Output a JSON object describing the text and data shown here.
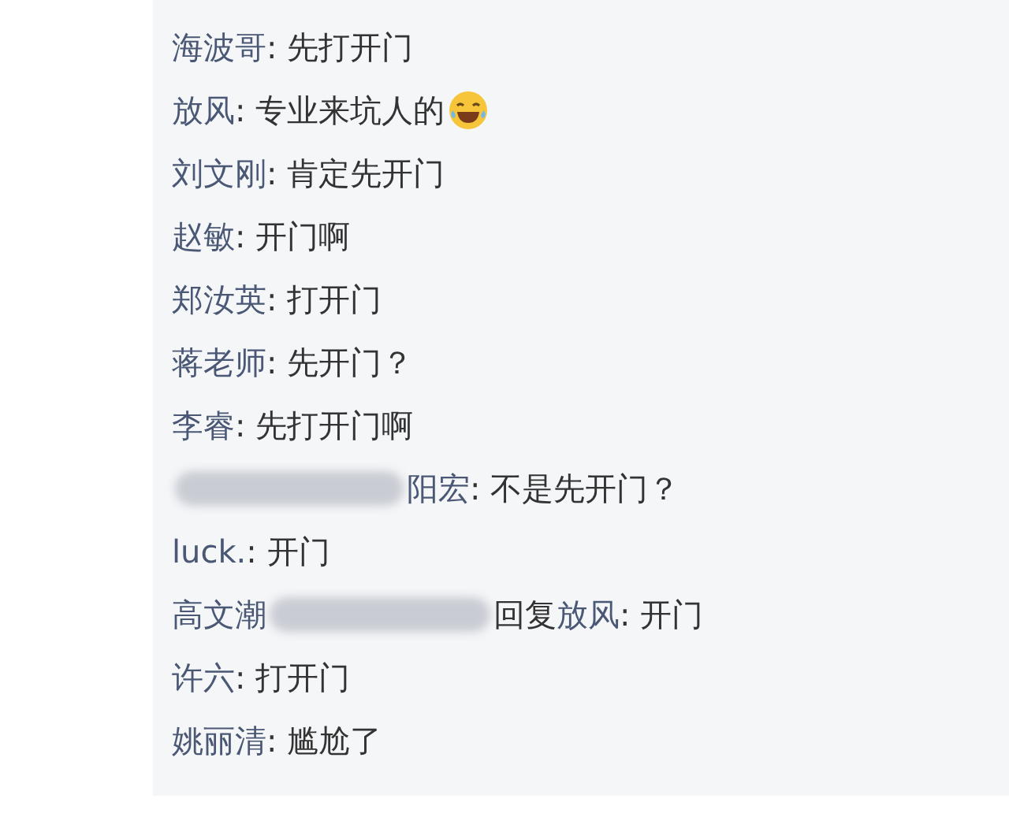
{
  "comments": [
    {
      "author": "海波哥",
      "text": ": 先打开门"
    },
    {
      "author": "放风",
      "text": ": 专业来坑人的",
      "emoji": true
    },
    {
      "author": "刘文刚",
      "text": ": 肯定先开门"
    },
    {
      "author": "赵敏",
      "text": ": 开门啊"
    },
    {
      "author": "郑汝英",
      "text": ": 打开门"
    },
    {
      "author": "蒋老师",
      "text": ": 先开门？"
    },
    {
      "author": "李睿",
      "text": ": 先打开门啊"
    },
    {
      "author": "阳宏",
      "redacted_before": true,
      "text": ": 不是先开门？"
    },
    {
      "author": "luck.",
      "text": ": 开门"
    },
    {
      "author": "高文潮",
      "redacted_after": true,
      "reply_label": "回复",
      "reply_to": "放风",
      "text": ": 开门"
    },
    {
      "author": "许六",
      "text": ": 打开门"
    },
    {
      "author": "姚丽清",
      "text": ": 尴尬了"
    }
  ]
}
